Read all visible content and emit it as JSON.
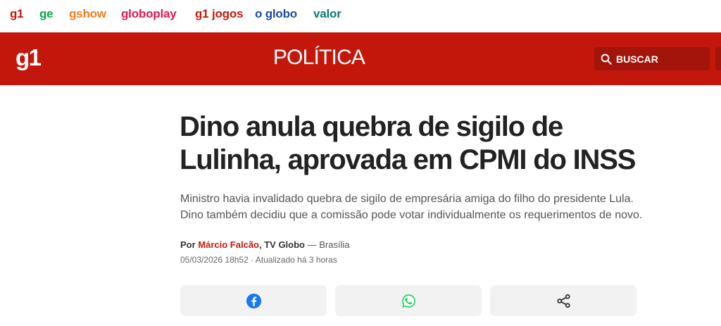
{
  "topnav": {
    "items": [
      {
        "label": "g1",
        "color": "#c4170c"
      },
      {
        "label": "ge",
        "color": "#06aa48"
      },
      {
        "label": "gshow",
        "color": "#f27d1b"
      },
      {
        "label": "globoplay",
        "color": "#e5164f"
      },
      {
        "label": "g1 jogos",
        "color": "#c4170c"
      },
      {
        "label": "o globo",
        "color": "#1a4b9b"
      },
      {
        "label": "valor",
        "color": "#0a7b78"
      }
    ]
  },
  "header": {
    "background": "#c4170c",
    "logo": "g1",
    "section": "POLÍTICA",
    "search_label": "BUSCAR",
    "search_background": "#a3140b",
    "search_icon": "search-icon"
  },
  "article": {
    "headline": "Dino anula quebra de sigilo de Lulinha, aprovada em CPMI do INSS",
    "subtitle": "Ministro havia invalidado quebra de sigilo de empresária amiga do filho do presidente Lula. Dino também decidiu que a comissão pode votar individualmente os requerimentos de novo.",
    "byline": {
      "prefix": "Por",
      "author": "Márcio Falcão",
      "outlet": ", TV Globo",
      "location": " — Brasília"
    },
    "dateline": "05/03/2026 18h52 · Atualizado há 3 horas"
  },
  "share": {
    "buttons": [
      {
        "icon": "facebook-icon",
        "color": "#1877f2"
      },
      {
        "icon": "whatsapp-icon",
        "color": "#25d366"
      },
      {
        "icon": "share-icon",
        "color": "#333333"
      }
    ]
  }
}
